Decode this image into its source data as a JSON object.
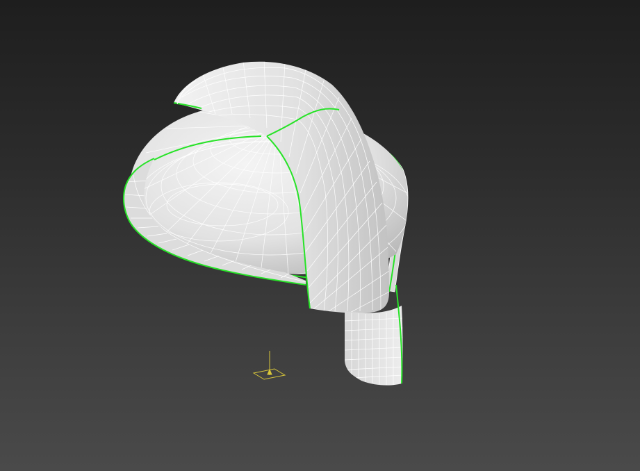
{
  "viewport": {
    "shading_mode": "edged-faces",
    "background_top": "#1e1e1e",
    "background_bottom": "#4a4a4a"
  },
  "model": {
    "type": "helmet-mesh",
    "parts": [
      "dome",
      "crossing-strap",
      "brim",
      "rear-flap"
    ],
    "surface_color": "#e6e6e6",
    "wire_color": "#ffffff",
    "selected_edge_color": "#27e327",
    "selected_edges": true
  },
  "gizmo": {
    "icon": "pivot-gizmo-icon",
    "color": "#d8c63a"
  }
}
